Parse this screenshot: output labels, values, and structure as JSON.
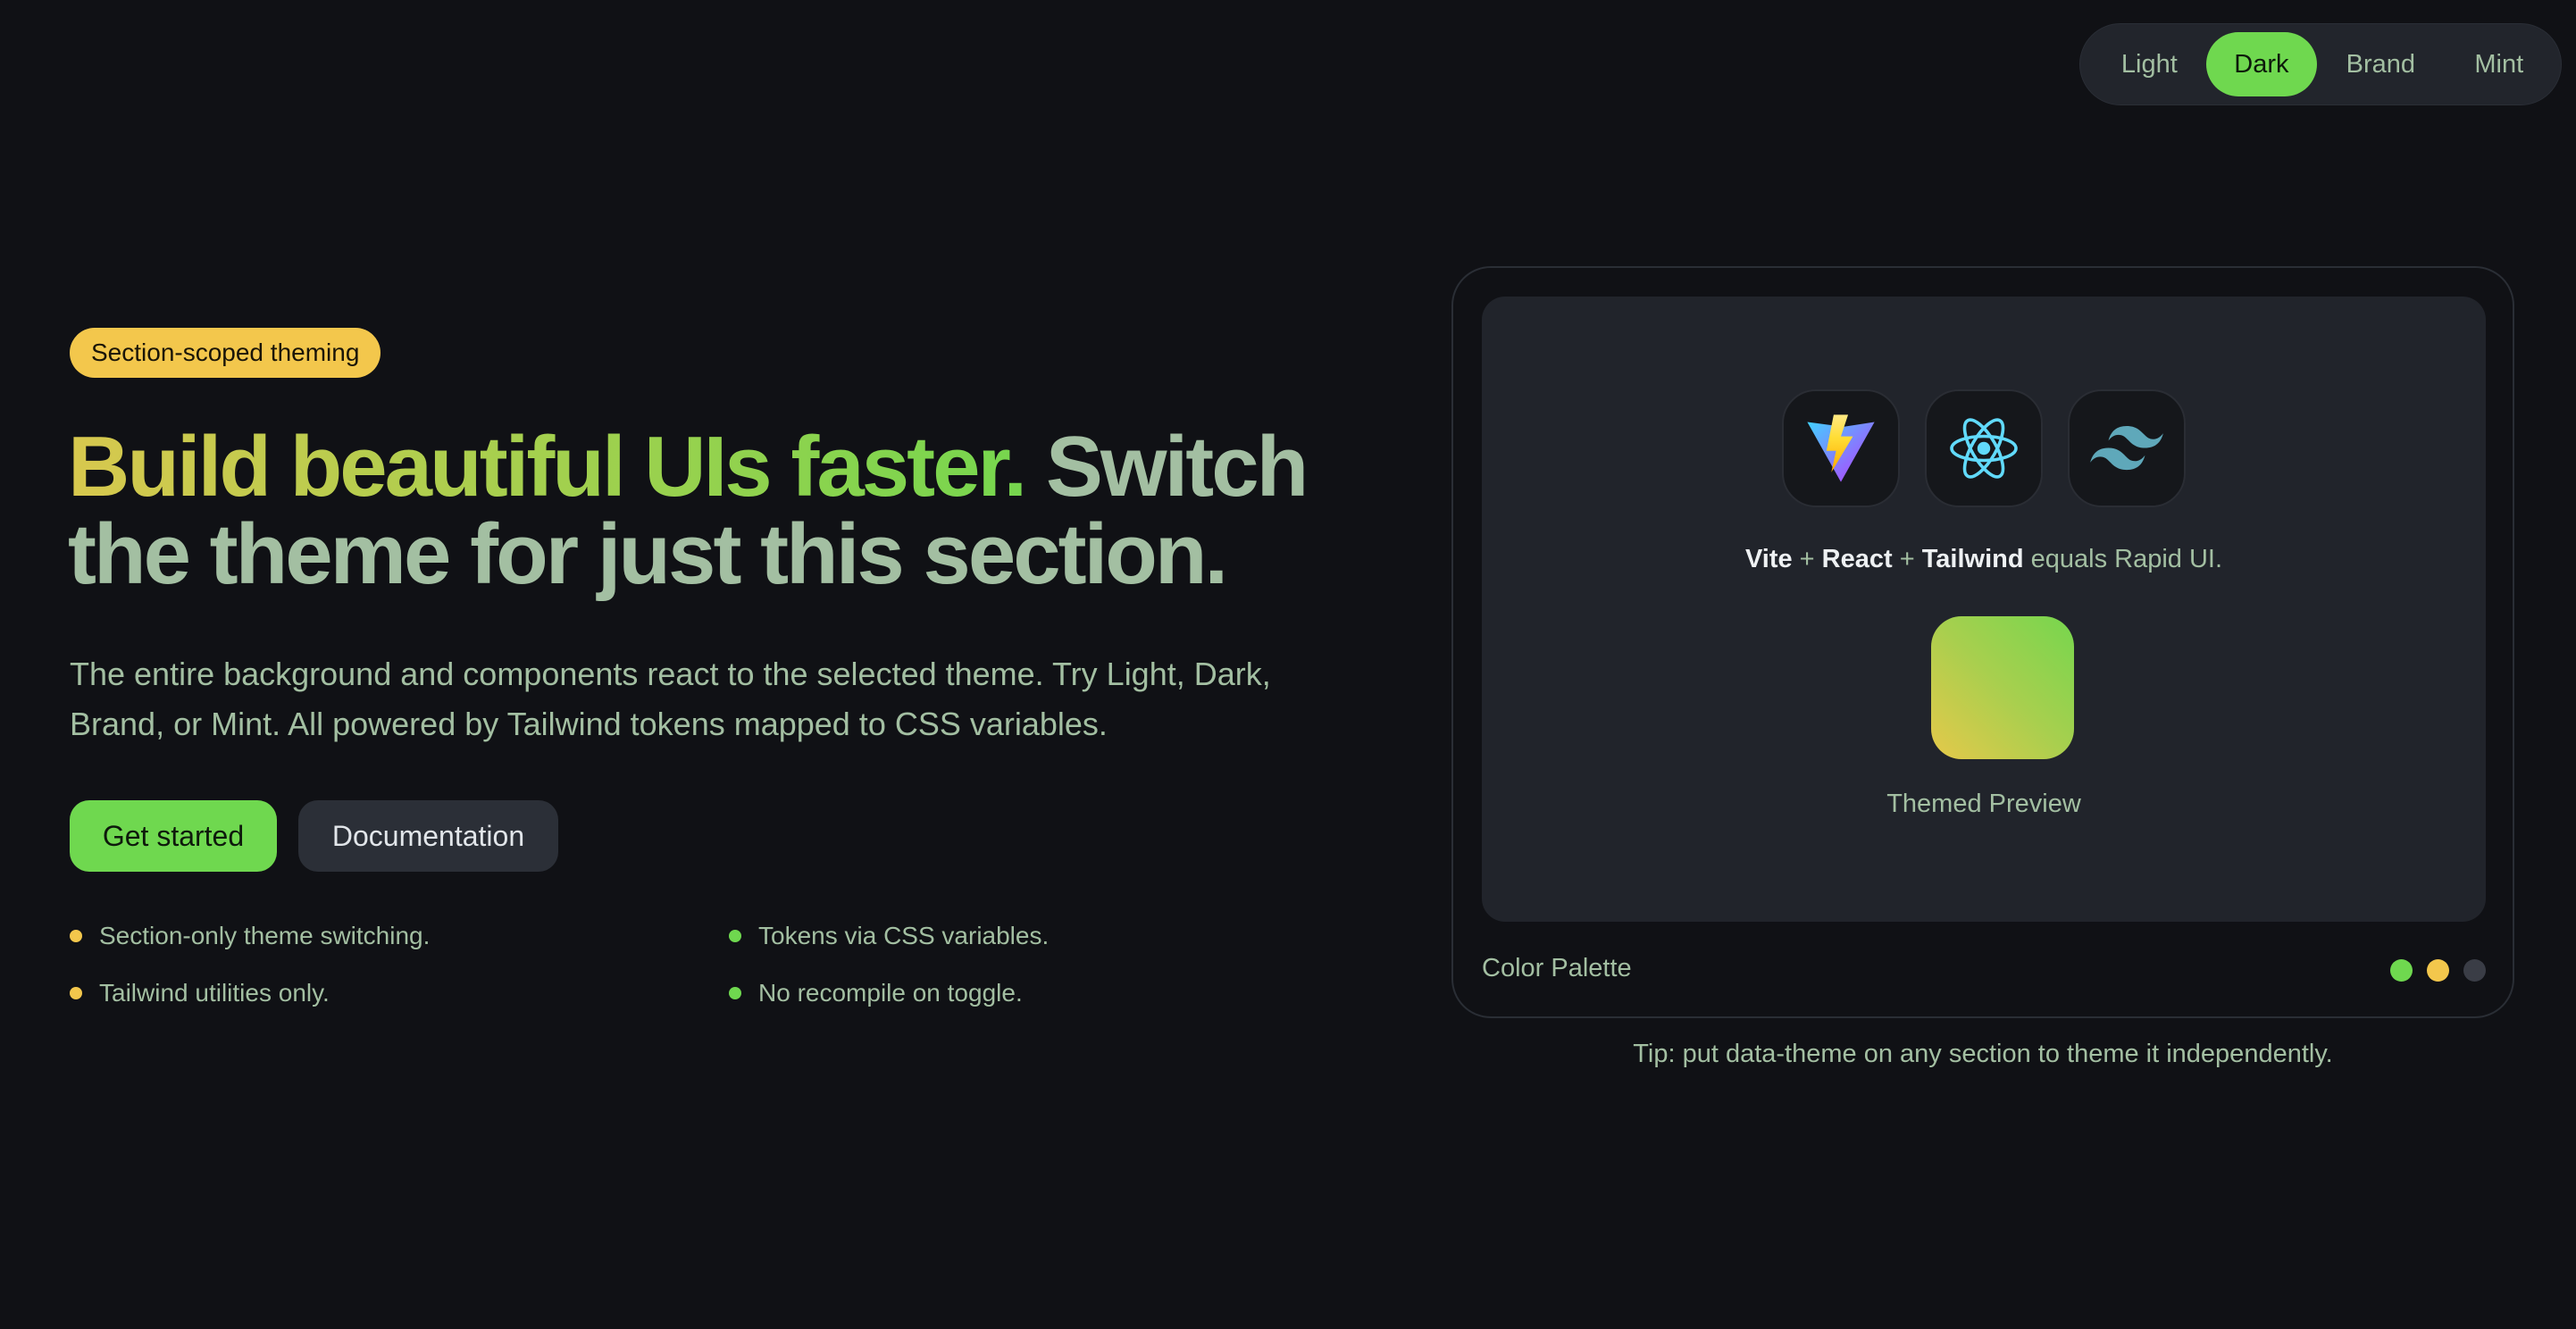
{
  "theme_switcher": {
    "options": [
      "Light",
      "Dark",
      "Brand",
      "Mint"
    ],
    "selected": "Dark"
  },
  "hero": {
    "badge": "Section-scoped theming",
    "headline_gradient": "Build beautiful UIs faster.",
    "headline_rest": " Switch the theme for just this section.",
    "lead": "The entire background and components react to the selected theme. Try Light, Dark, Brand, or Mint. All powered by Tailwind tokens mapped to CSS variables.",
    "primary_button": "Get started",
    "secondary_button": "Documentation",
    "features": [
      {
        "text": "Section-only theme switching.",
        "dot_color": "#f3c74c"
      },
      {
        "text": "Tailwind utilities only.",
        "dot_color": "#f3c74c"
      },
      {
        "text": "Tokens via CSS variables.",
        "dot_color": "#6fd84f"
      },
      {
        "text": "No recompile on toggle.",
        "dot_color": "#6fd84f"
      }
    ]
  },
  "preview_card": {
    "icons": [
      "vite-icon",
      "react-icon",
      "tailwind-icon"
    ],
    "stack": {
      "vite": "Vite",
      "plus1": " + ",
      "react": "React",
      "plus2": " + ",
      "tailwind": "Tailwind",
      "rest": " equals Rapid UI."
    },
    "preview_label": "Themed Preview",
    "palette_label": "Color Palette",
    "palette_colors": [
      "#6fd84f",
      "#f3c74c",
      "#3a3d46"
    ]
  },
  "tip": "Tip: put data-theme on any section to theme it independently.",
  "colors": {
    "background": "#101115",
    "accent": "#6fd84f",
    "secondary_accent": "#f3c74c",
    "text_muted": "#a3bfa2"
  }
}
